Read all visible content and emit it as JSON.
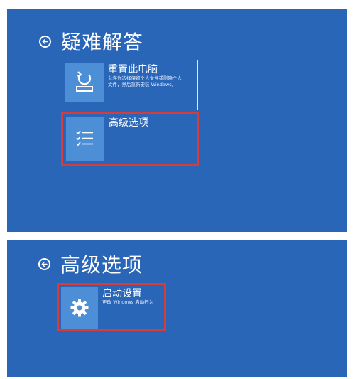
{
  "colors": {
    "background": "#2a66b8",
    "tile": "#4d8fd6",
    "highlight": "#d63c3c"
  },
  "top_screen": {
    "title": "疑难解答",
    "back_icon": "back-arrow-circle-icon",
    "tiles": [
      {
        "icon": "reset-pc-icon",
        "label": "重置此电脑",
        "description_line1": "允许你选择保留个人文件或删除个人",
        "description_line2": "文件，然后重新安装 Windows。"
      },
      {
        "icon": "checklist-icon",
        "label": "高级选项"
      }
    ]
  },
  "bottom_screen": {
    "title": "高级选项",
    "back_icon": "back-arrow-circle-icon",
    "tiles": [
      {
        "icon": "gear-icon",
        "label": "启动设置",
        "description": "更改 Windows 启动行为"
      }
    ]
  }
}
